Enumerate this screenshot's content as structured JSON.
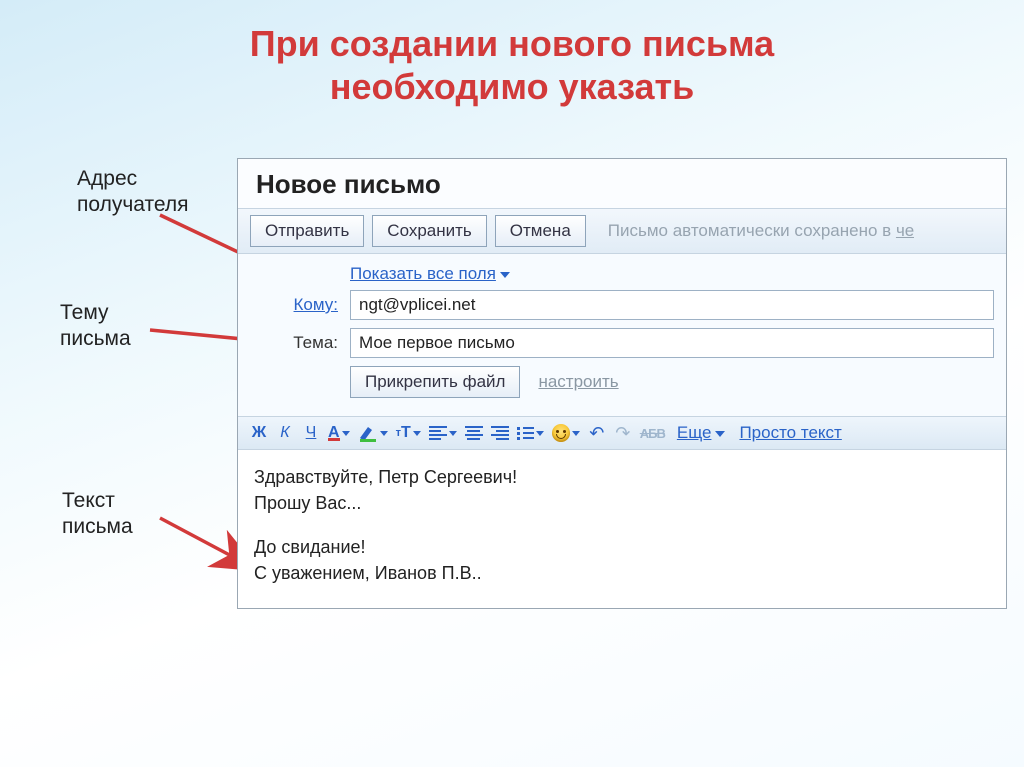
{
  "slide": {
    "title_line1": "При создании нового письма",
    "title_line2": "необходимо указать"
  },
  "labels": {
    "recipient": "Адрес\nполучателя",
    "subject": "Тему письма",
    "body": "Текст письма"
  },
  "panel": {
    "header": "Новое письмо",
    "buttons": {
      "send": "Отправить",
      "save": "Сохранить",
      "cancel": "Отмена"
    },
    "status_prefix": "Письмо автоматически сохранено в ",
    "status_link": "че",
    "show_all_fields": "Показать все поля",
    "to_label": "Кому:",
    "to_value": "ngt@vplicei.net",
    "subject_label": "Тема:",
    "subject_value": "Мое первое письмо",
    "attach": "Прикрепить файл",
    "configure": "настроить"
  },
  "format": {
    "bold": "Ж",
    "italic": "К",
    "underline": "Ч",
    "color": "А",
    "size_big": "т",
    "size_small": "Т",
    "strike_sample": "АБВ",
    "more": "Еще",
    "plain": "Просто текст"
  },
  "body": {
    "line1": "Здравствуйте, Петр Сергеевич!",
    "line2": "Прошу Вас...",
    "line3": "До свидание!",
    "line4": "С уважением, Иванов П.В.."
  }
}
